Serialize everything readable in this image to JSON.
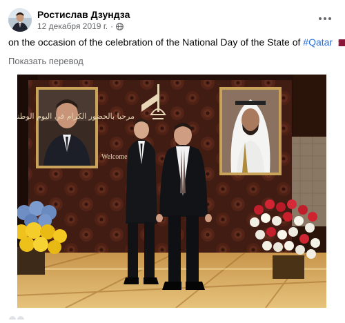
{
  "post": {
    "author": "Ростислав Дзундза",
    "date": "12 декабря 2019 г.",
    "separator": "·",
    "privacy_icon": "globe-icon",
    "text_prefix": "on the occasion of the celebration of the National Day of the State of ",
    "hashtag": "#Qatar",
    "flag_icon": "flag-qatar-icon",
    "translate_label": "Показать перевод",
    "more_icon": "more-horizontal-icon"
  },
  "photo": {
    "arabic_text": "مرحبا بالحضور الكرام في اليوم الوطني لدولة قطر",
    "welcome_text": "Welcome"
  },
  "colors": {
    "name_text": "#050505",
    "meta_text": "#65676b",
    "hashtag": "#216fdb",
    "qatar_maroon": "#8a1538"
  }
}
